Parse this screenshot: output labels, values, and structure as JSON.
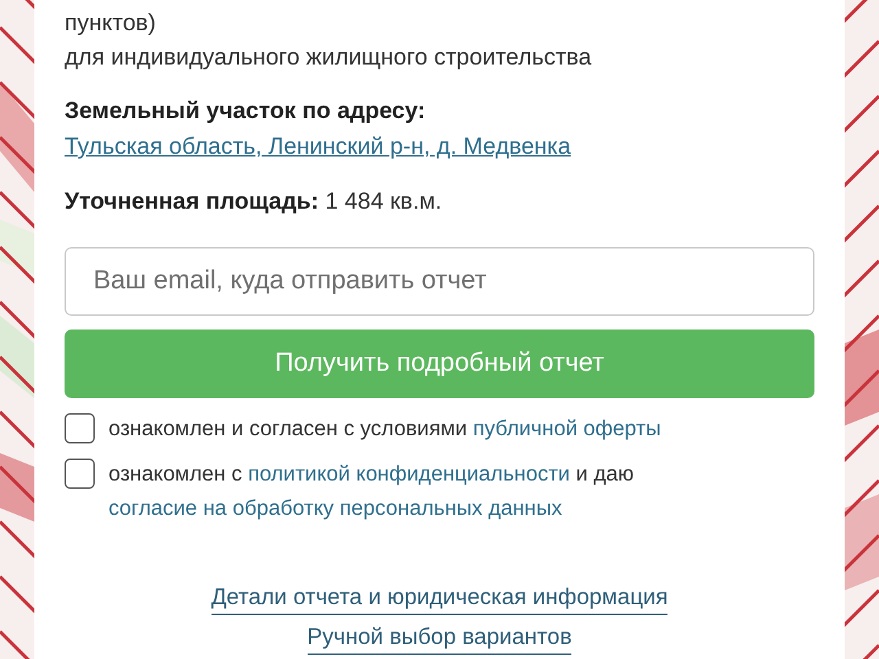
{
  "description": {
    "lines": [
      "пунктов)",
      "для индивидуального жилищного строительства"
    ]
  },
  "address": {
    "label": "Земельный участок по адресу:",
    "link": "Тульская область, Ленинский р-н, д. Медвенка"
  },
  "area": {
    "label": "Уточненная площадь:",
    "value": "1 484 кв.м."
  },
  "email_field": {
    "placeholder": "Ваш email, куда отправить отчет"
  },
  "submit_button": "Получить подробный отчет",
  "agreements": [
    {
      "checked": false,
      "parts": [
        {
          "kind": "text",
          "text": "ознакомлен и согласен с условиями"
        },
        {
          "kind": "link",
          "text": "публичной оферты"
        }
      ]
    },
    {
      "checked": false,
      "parts": [
        {
          "kind": "text",
          "text": "ознакомлен с"
        },
        {
          "kind": "link",
          "text": "политикой конфиденциальности"
        },
        {
          "kind": "text",
          "text": "и даю"
        },
        {
          "kind": "link",
          "text": "согласие на обработку персональных данных"
        }
      ]
    }
  ],
  "footer_links": [
    "Детали отчета и юридическая информация",
    "Ручной выбор вариантов"
  ]
}
